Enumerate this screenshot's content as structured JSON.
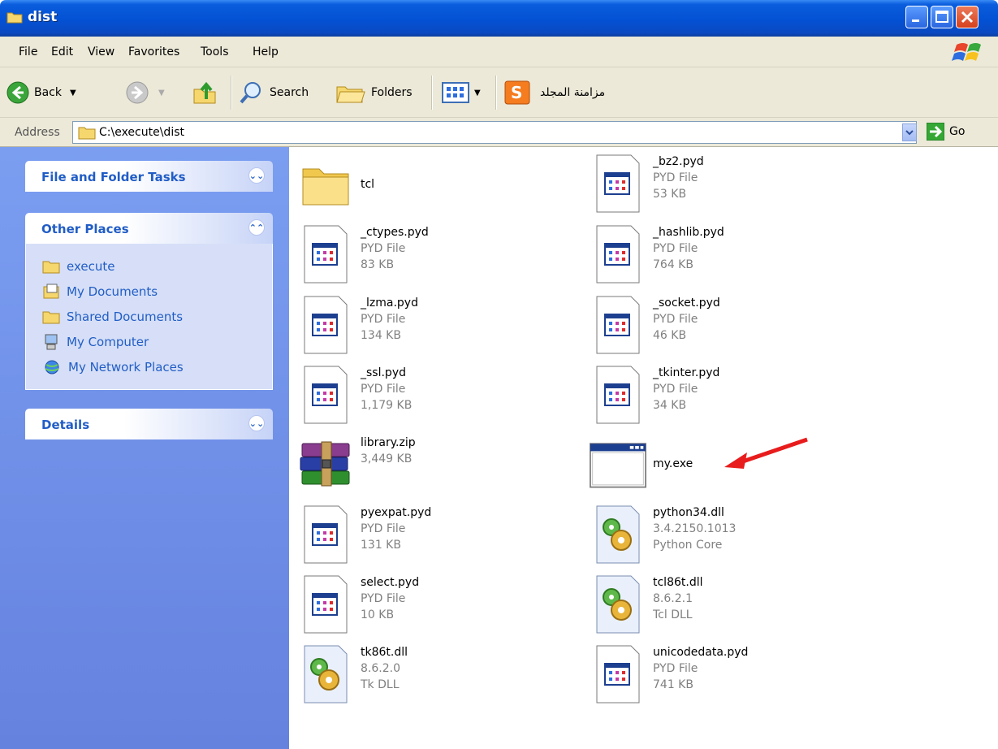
{
  "window": {
    "title": "dist"
  },
  "menu": [
    "File",
    "Edit",
    "View",
    "Favorites",
    "Tools",
    "Help"
  ],
  "toolbar": {
    "back": "Back",
    "search": "Search",
    "folders": "Folders",
    "sync": "مزامنة المجلد"
  },
  "address": {
    "label": "Address",
    "path": "C:\\execute\\dist",
    "go": "Go"
  },
  "sidebar": {
    "file_tasks": "File and Folder Tasks",
    "other_places": "Other Places",
    "places": [
      {
        "label": "execute",
        "icon": "folder-icon"
      },
      {
        "label": "My Documents",
        "icon": "documents-icon"
      },
      {
        "label": "Shared Documents",
        "icon": "folder-icon"
      },
      {
        "label": "My Computer",
        "icon": "computer-icon"
      },
      {
        "label": "My Network Places",
        "icon": "network-icon"
      }
    ],
    "details": "Details"
  },
  "files": {
    "tcl": {
      "name": "tcl"
    },
    "bz2": {
      "name": "_bz2.pyd",
      "type": "PYD File",
      "size": "53 KB"
    },
    "ctypes": {
      "name": "_ctypes.pyd",
      "type": "PYD File",
      "size": "83 KB"
    },
    "hashlib": {
      "name": "_hashlib.pyd",
      "type": "PYD File",
      "size": "764 KB"
    },
    "lzma": {
      "name": "_lzma.pyd",
      "type": "PYD File",
      "size": "134 KB"
    },
    "socket": {
      "name": "_socket.pyd",
      "type": "PYD File",
      "size": "46 KB"
    },
    "ssl": {
      "name": "_ssl.pyd",
      "type": "PYD File",
      "size": "1,179 KB"
    },
    "tkinter": {
      "name": "_tkinter.pyd",
      "type": "PYD File",
      "size": "34 KB"
    },
    "library": {
      "name": "library.zip",
      "size": "3,449 KB"
    },
    "myexe": {
      "name": "my.exe"
    },
    "pyexpat": {
      "name": "pyexpat.pyd",
      "type": "PYD File",
      "size": "131 KB"
    },
    "python34": {
      "name": "python34.dll",
      "version": "3.4.2150.1013",
      "desc": "Python Core"
    },
    "select": {
      "name": "select.pyd",
      "type": "PYD File",
      "size": "10 KB"
    },
    "tcl86t": {
      "name": "tcl86t.dll",
      "version": "8.6.2.1",
      "desc": "Tcl DLL"
    },
    "tk86t": {
      "name": "tk86t.dll",
      "version": "8.6.2.0",
      "desc": "Tk DLL"
    },
    "unicodedata": {
      "name": "unicodedata.pyd",
      "type": "PYD File",
      "size": "741 KB"
    }
  }
}
